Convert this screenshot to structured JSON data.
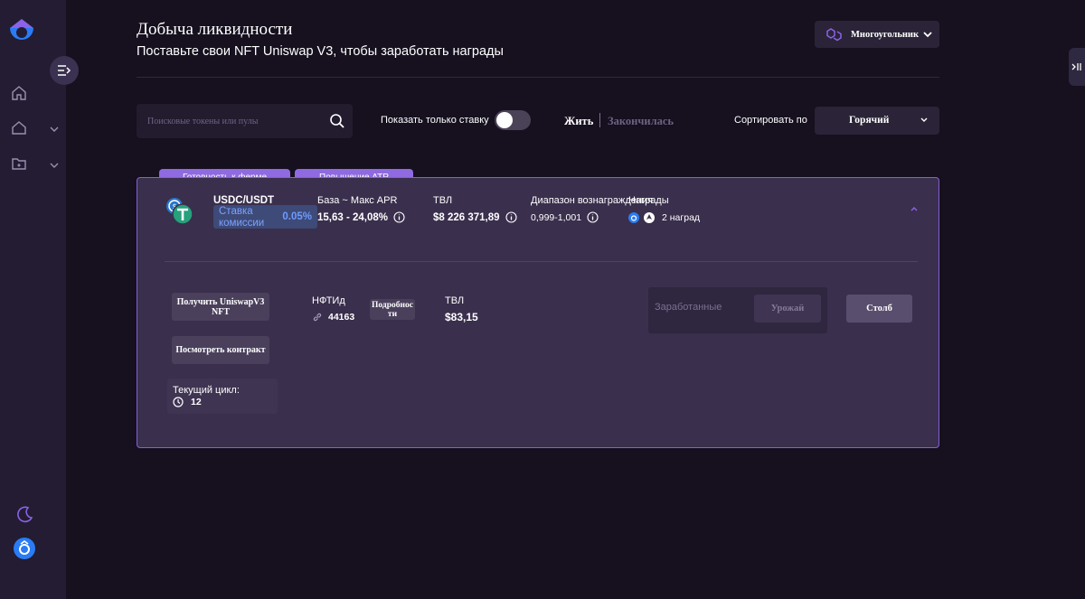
{
  "header": {
    "title": "Добыча ликвидности",
    "subtitle": "Поставьте свои NFT Uniswap V3, чтобы заработать награды",
    "network": "Многоугольник"
  },
  "filters": {
    "search_placeholder": "Поисковые токены или пулы",
    "staked_only_label": "Показать только ставку",
    "staked_only_on": false,
    "tab_live": "Жить",
    "tab_finished": "Закончилась",
    "sort_label": "Сортировать по",
    "sort_value": "Горячий"
  },
  "pool": {
    "tags": [
      "Готовность к ферме",
      "Повышение АТР"
    ],
    "pair": "USDC/USDT",
    "fee_label": "Ставка комиссии",
    "fee_value": "0.05%",
    "apr_label": "База ~ Макс APR",
    "apr_value": "15,63 - 24,08%",
    "tvl_label": "ТВЛ",
    "tvl_value": "$8 226 371,89",
    "range_label": "Диапазон вознаграждения",
    "range_value": "0,999-1,001",
    "rewards_label": "Награды",
    "rewards_value": "2 наград",
    "get_nft_button": "Получить UniswapV3 NFT",
    "view_contract_button": "Посмотреть контракт",
    "nft_id_label": "НФТИд",
    "nft_id_value": "44163",
    "details_button": "Подробности",
    "tvl2_label": "ТВЛ",
    "tvl2_value": "$83,15",
    "earned_label": "Заработанные",
    "harvest_button": "Урожай",
    "stake_button": "Столб",
    "cycle_label": "Текущий цикл:",
    "cycle_value": "12"
  },
  "colors": {
    "background": "#16101f",
    "sidebar": "#231c33",
    "card": "#3a2f4d",
    "accent": "#8f6ae0",
    "fee_blue": "#6d9cff"
  }
}
